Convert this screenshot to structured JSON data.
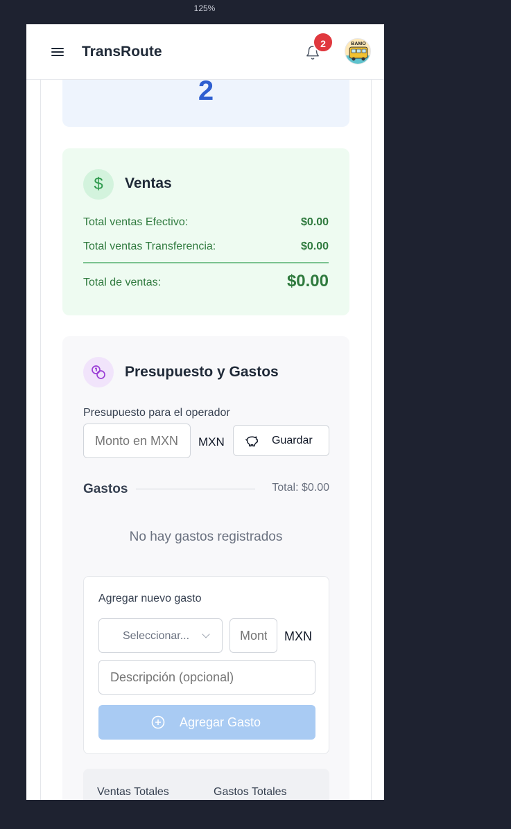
{
  "zoom": "125%",
  "header": {
    "brand": "TransRoute",
    "notification_count": "2",
    "avatar_text": "BAMO"
  },
  "stat": {
    "value": "2"
  },
  "ventas": {
    "title": "Ventas",
    "rows": [
      {
        "label": "Total ventas Efectivo:",
        "value": "$0.00"
      },
      {
        "label": "Total ventas Transferencia:",
        "value": "$0.00"
      }
    ],
    "total_label": "Total de ventas:",
    "total_value": "$0.00"
  },
  "budget": {
    "title": "Presupuesto y Gastos",
    "label": "Presupuesto para el operador",
    "amount_placeholder": "Monto en MXN",
    "currency": "MXN",
    "save_label": "Guardar",
    "gastos_label": "Gastos",
    "gastos_total": "Total: $0.00",
    "empty_text": "No hay gastos registrados",
    "new_expense": {
      "title": "Agregar nuevo gasto",
      "select_placeholder": "Seleccionar...",
      "amount_placeholder": "Monto",
      "currency": "MXN",
      "description_placeholder": "Descripción (opcional)",
      "add_label": "Agregar Gasto"
    },
    "summary": {
      "ventas_totales": "Ventas Totales",
      "gastos_totales": "Gastos Totales"
    }
  },
  "colors": {
    "accent_blue": "#2f5fd0",
    "sales_green": "#2f7a3e",
    "badge_red": "#e0383e",
    "disabled_button": "#a9cbf3"
  }
}
